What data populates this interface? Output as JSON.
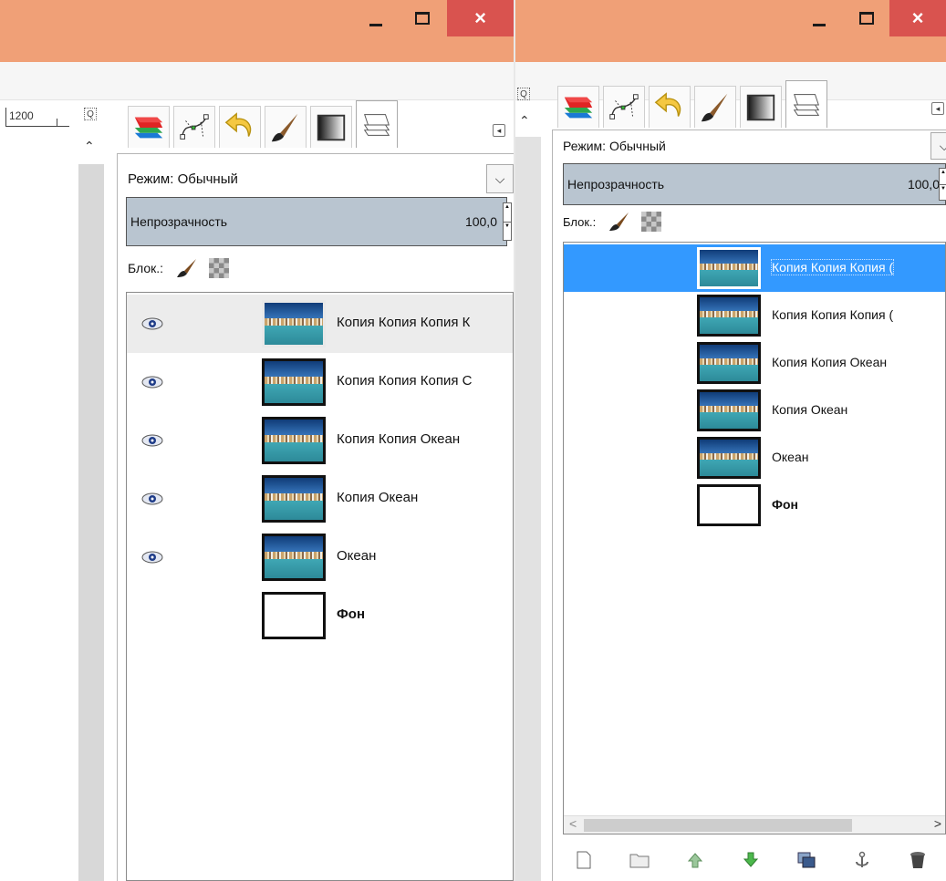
{
  "left_window": {
    "ruler_value": "1200",
    "mode_label": "Режим: Обычный",
    "opacity_label": "Непрозрачность",
    "opacity_value": "100,0",
    "lock_label": "Блок.:",
    "layers": [
      {
        "name": "Копия Копия Копия К",
        "visible": true,
        "bold": false,
        "blank": false
      },
      {
        "name": "Копия Копия Копия С",
        "visible": true,
        "bold": false,
        "blank": false
      },
      {
        "name": "Копия Копия Океан",
        "visible": true,
        "bold": false,
        "blank": false
      },
      {
        "name": "Копия Океан",
        "visible": true,
        "bold": false,
        "blank": false
      },
      {
        "name": "Океан",
        "visible": true,
        "bold": false,
        "blank": false
      },
      {
        "name": "Фон",
        "visible": false,
        "bold": true,
        "blank": true
      }
    ]
  },
  "right_window": {
    "mode_label": "Режим: Обычный",
    "opacity_label": "Непрозрачность",
    "opacity_value": "100,0",
    "lock_label": "Блок.:",
    "selected_color": "#3399ff",
    "layers": [
      {
        "name": "Копия Копия Копия (",
        "selected": true,
        "bold": false,
        "blank": false
      },
      {
        "name": "Копия Копия Копия (",
        "selected": false,
        "bold": false,
        "blank": false
      },
      {
        "name": "Копия Копия Океан",
        "selected": false,
        "bold": false,
        "blank": false
      },
      {
        "name": "Копия Океан",
        "selected": false,
        "bold": false,
        "blank": false
      },
      {
        "name": "Океан",
        "selected": false,
        "bold": false,
        "blank": false
      },
      {
        "name": "Фон",
        "selected": false,
        "bold": true,
        "blank": true
      }
    ]
  },
  "window_buttons": {
    "minimize": "—",
    "maximize": "☐",
    "close": "×"
  },
  "colors": {
    "titlebar": "#f0a077",
    "close_button": "#d9534f",
    "opacity_bar": "#b9c5d0"
  },
  "tab_icons": [
    "layers-icon",
    "paths-icon",
    "undo-history-icon",
    "brush-icon",
    "gradient-icon",
    "layers-stack-icon"
  ],
  "bottom_buttons": [
    "new-layer-icon",
    "new-layer-group-icon",
    "raise-layer-icon",
    "lower-layer-icon",
    "duplicate-layer-icon",
    "anchor-layer-icon",
    "delete-layer-icon"
  ]
}
